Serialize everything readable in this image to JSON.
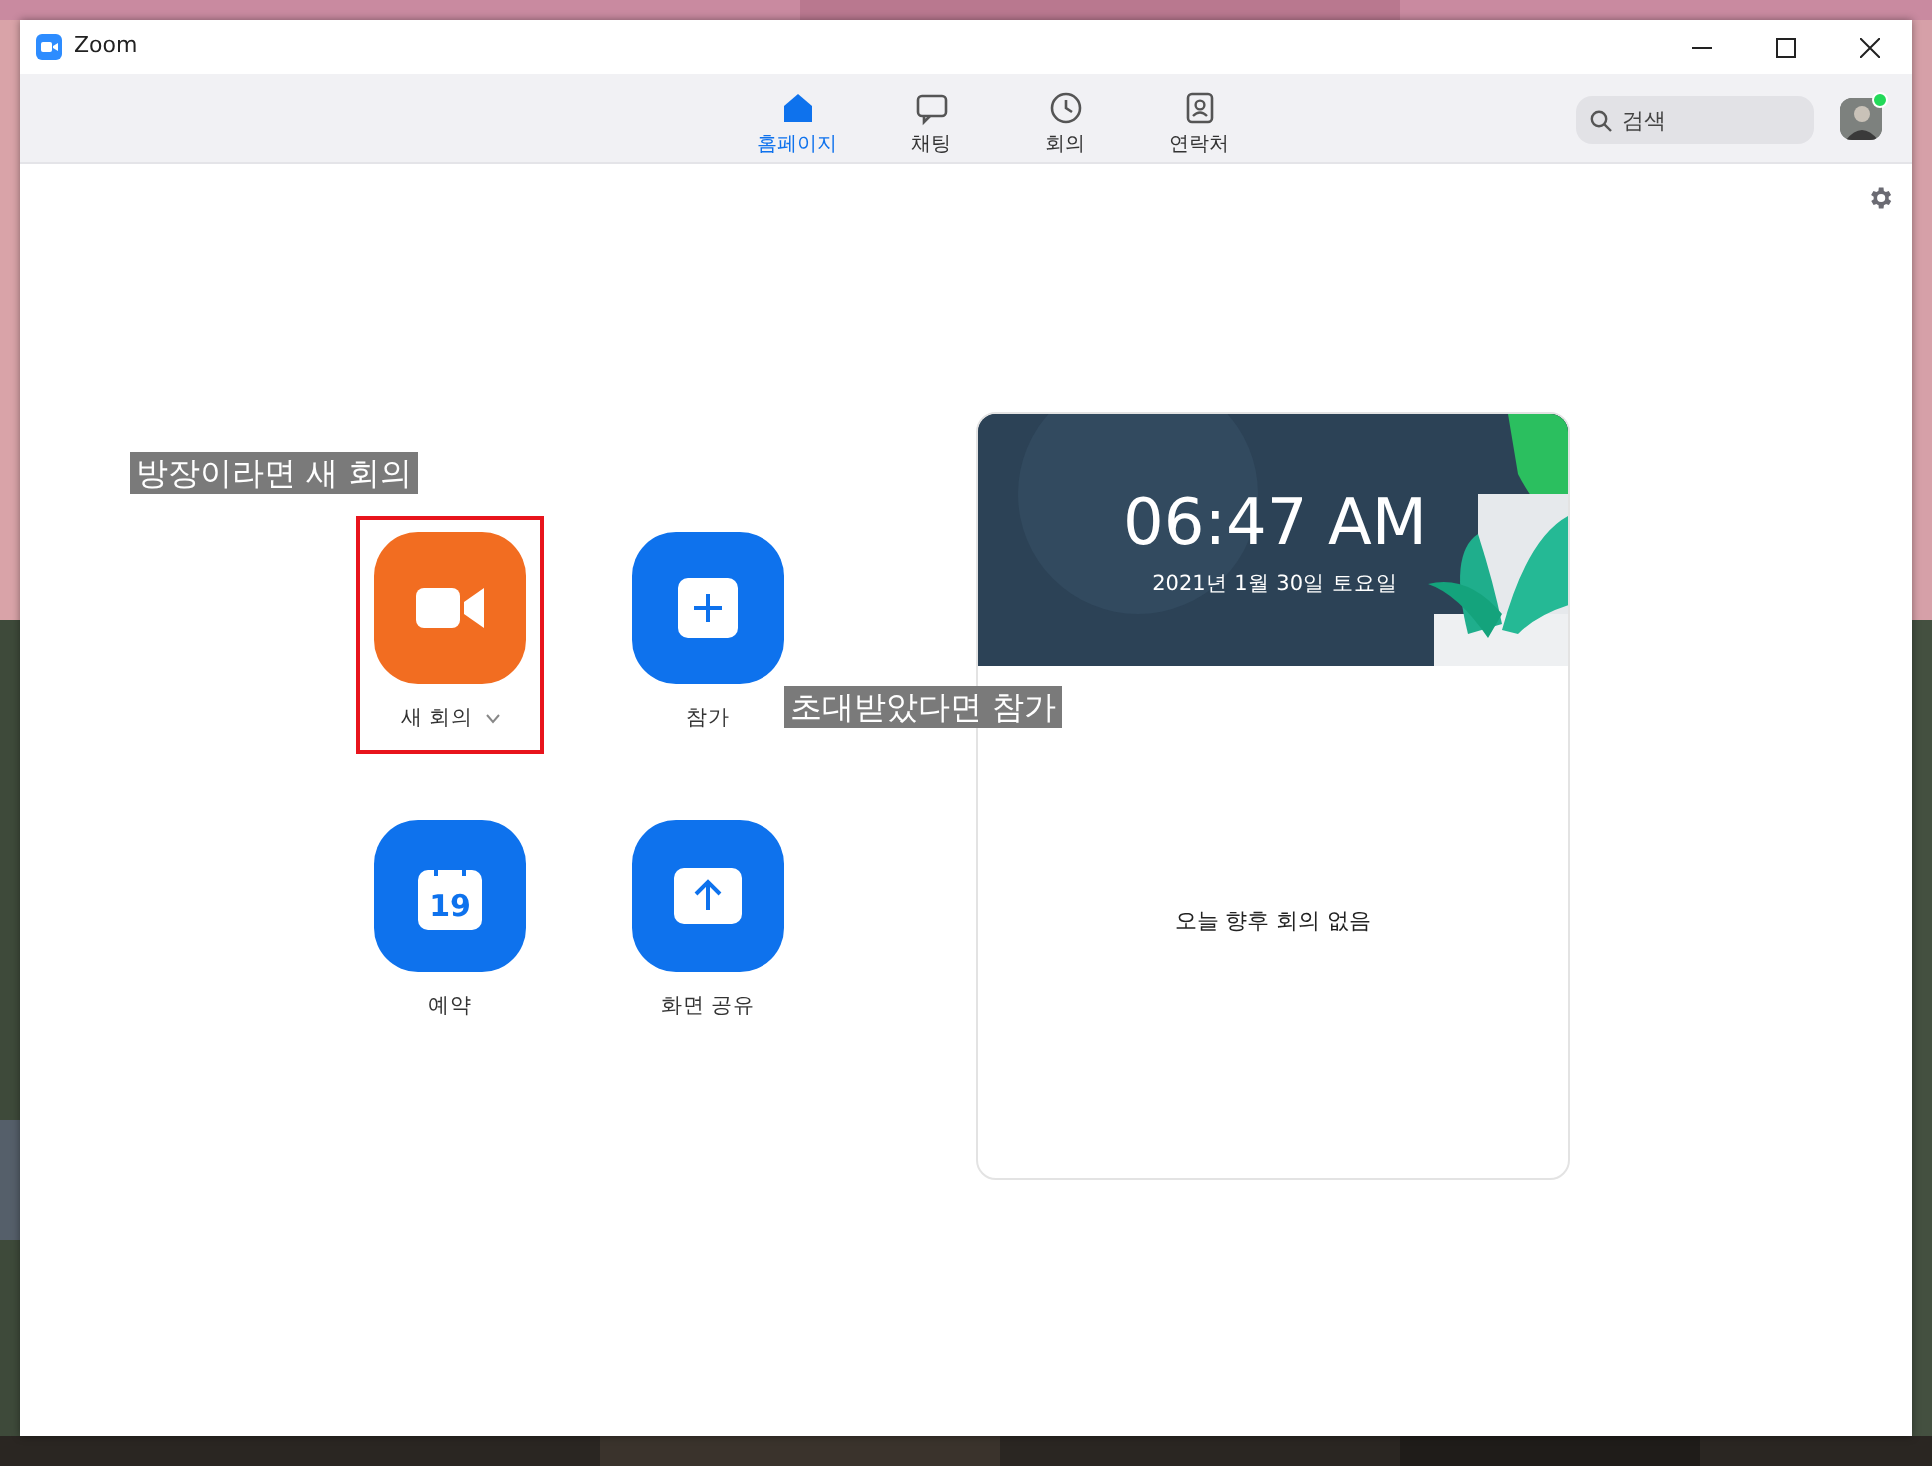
{
  "window": {
    "title": "Zoom"
  },
  "nav_tabs": [
    {
      "label": "홈페이지",
      "kind": "home",
      "selected": true
    },
    {
      "label": "채팅",
      "kind": "chat",
      "selected": false
    },
    {
      "label": "회의",
      "kind": "clock",
      "selected": false
    },
    {
      "label": "연락처",
      "kind": "contacts",
      "selected": false
    }
  ],
  "search": {
    "placeholder": "검색"
  },
  "profile": {
    "online": true
  },
  "actions": [
    {
      "label": "새 회의",
      "kind": "video",
      "color": "#f26d21",
      "dropdown": true,
      "highlighted": true
    },
    {
      "label": "참가",
      "kind": "join",
      "color": "#0e72ed",
      "dropdown": false,
      "highlighted": false
    },
    {
      "label": "예약",
      "kind": "calendar",
      "color": "#0e72ed",
      "day": "19",
      "dropdown": false,
      "highlighted": false
    },
    {
      "label": "화면 공유",
      "kind": "share",
      "color": "#0e72ed",
      "dropdown": false,
      "highlighted": false
    }
  ],
  "calendar_card": {
    "time": "06:47 AM",
    "date": "2021년 1월 30일 토요일",
    "empty_message": "오늘 향후 회의 없음"
  },
  "annotations": [
    "방장이라면 새 회의",
    "초대받았다면 참가"
  ]
}
